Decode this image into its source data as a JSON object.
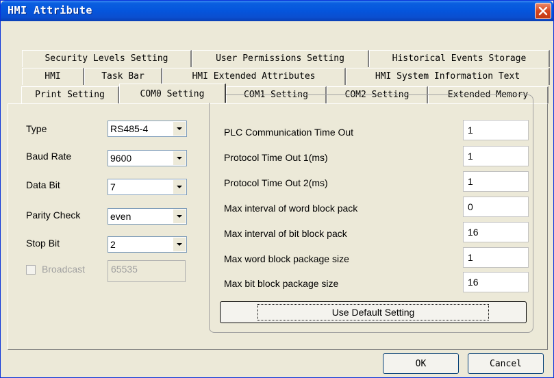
{
  "window": {
    "title": "HMI Attribute"
  },
  "tabs": {
    "row1": [
      "Security Levels Setting",
      "User Permissions Setting",
      "Historical Events Storage"
    ],
    "row2": [
      "HMI",
      "Task Bar",
      "HMI Extended Attributes",
      "HMI System Information Text"
    ],
    "row3": [
      "Print Setting",
      "COM0 Setting",
      "COM1 Setting",
      "COM2 Setting",
      "Extended Memory"
    ]
  },
  "com": {
    "type_label": "Type",
    "type_value": "RS485-4",
    "baud_label": "Baud Rate",
    "baud_value": "9600",
    "databit_label": "Data Bit",
    "databit_value": "7",
    "parity_label": "Parity Check",
    "parity_value": "even",
    "stopbit_label": "Stop Bit",
    "stopbit_value": "2",
    "broadcast_label": "Broadcast",
    "broadcast_value": "65535"
  },
  "timing": [
    {
      "label": "PLC Communication Time Out",
      "value": "1"
    },
    {
      "label": "Protocol Time Out 1(ms)",
      "value": "1"
    },
    {
      "label": "Protocol Time Out 2(ms)",
      "value": "1"
    },
    {
      "label": "Max interval of word block pack",
      "value": "0"
    },
    {
      "label": "Max interval of bit block pack",
      "value": "16"
    },
    {
      "label": "Max word block package size",
      "value": "1"
    },
    {
      "label": "Max bit block package size",
      "value": "16"
    }
  ],
  "buttons": {
    "default": "Use Default Setting",
    "ok": "OK",
    "cancel": "Cancel"
  }
}
